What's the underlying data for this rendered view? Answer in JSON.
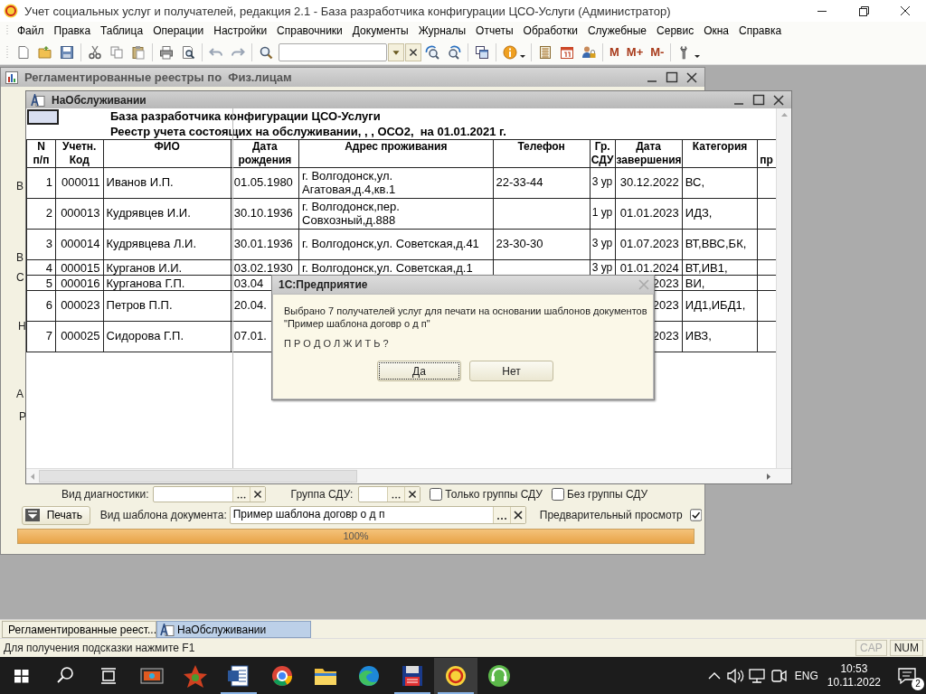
{
  "window": {
    "title": "Учет социальных услуг и получателей, редакция 2.1 - База разработчика конфигурации ЦСО-Услуги (Администратор)"
  },
  "menu": [
    "Файл",
    "Правка",
    "Таблица",
    "Операции",
    "Настройки",
    "Справочники",
    "Документы",
    "Журналы",
    "Отчеты",
    "Обработки",
    "Служебные",
    "Сервис",
    "Окна",
    "Справка"
  ],
  "toolbar": {
    "memory_buttons": [
      "M",
      "M+",
      "M-"
    ]
  },
  "back_window": {
    "title": "Регламентированные реестры по  Физ.лицам",
    "covered_labels": [
      "В",
      "В",
      "С",
      "Н",
      "А",
      "Р"
    ],
    "form": {
      "diagnostic": {
        "label": "Вид диагностики:"
      },
      "group": {
        "label": "Группа СДУ:"
      },
      "checkboxes": [
        {
          "label": "Только группы СДУ",
          "checked": false
        },
        {
          "label": "Без группы СДУ",
          "checked": false
        }
      ],
      "print_button": "Печать",
      "template": {
        "label": "Вид шаблона документа:",
        "value": "Пример шаблона договр о д п"
      },
      "preview": {
        "label": "Предварительный просмотр",
        "checked": true
      },
      "progress": {
        "level": 1,
        "reading": "100%"
      }
    }
  },
  "report_window": {
    "title": "НаОбслуживании",
    "heading": "База разработчика конфигурации ЦСО-Услуги",
    "subtitle": "Реестр учета состоящих на обслуживании, , , ОСО2,  на 01.01.2021 г.",
    "table": {
      "columns": [
        "N\nп/п",
        "Учетн.\nКод",
        "ФИО",
        "Дата\nрождения",
        "Адрес проживания",
        "Телефон",
        "Гр.\nСДУ",
        "Дата\nзавершения",
        "Категория",
        "пр"
      ],
      "rows": [
        [
          "1",
          "000011",
          "Иванов И.П.",
          "01.05.1980",
          "г. Волгодонск,ул.\nАгатовая,д.4,кв.1",
          "22-33-44",
          "3 ур",
          "30.12.2022",
          "ВС,",
          ""
        ],
        [
          "2",
          "000013",
          "Кудрявцев И.И.",
          "30.10.1936",
          "г. Волгодонск,пер.\nСовхозный,д.888",
          "",
          "1 ур",
          "01.01.2023",
          "ИДЗ,",
          ""
        ],
        [
          "3",
          "000014",
          "Кудрявцева Л.И.",
          "30.01.1936",
          "г. Волгодонск,ул. Советская,д.41",
          "23-30-30",
          "3 ур",
          "01.07.2023",
          "ВТ,ВВС,БК,",
          ""
        ],
        [
          "4",
          "000015",
          "Курганов И.И.",
          "03.02.1930",
          "г. Волгодонск,ул. Советская,д.1",
          "",
          "3 ур",
          "01.01.2024",
          "ВТ,ИВ1,",
          ""
        ],
        [
          "5",
          "000016",
          "Курганова Г.П.",
          "03.04",
          "",
          "",
          "",
          "2023",
          "ВИ,",
          ""
        ],
        [
          "6",
          "000023",
          "Петров П.П.",
          "20.04.",
          "",
          "",
          "",
          "2023",
          "ИД1,ИБД1,",
          ""
        ],
        [
          "7",
          "000025",
          "Сидорова Г.П.",
          "07.01.",
          "",
          "",
          "",
          "2023",
          "ИВЗ,",
          ""
        ]
      ]
    }
  },
  "dialog": {
    "title": "1С:Предприятие",
    "message": "Выбрано 7 получателей услуг для печати на основании шаблонов документов\n\"Пример шаблона договр о д п\"",
    "question": "П Р О Д О Л Ж И Т Ь ?",
    "buttons": [
      {
        "label": "Да",
        "focused": true
      },
      {
        "label": "Нет",
        "focused": false
      }
    ]
  },
  "window_tabs": [
    {
      "label": "Регламентированные реест...",
      "selected": false
    },
    {
      "label": "НаОбслуживании",
      "selected": true
    }
  ],
  "status_bar": {
    "hint": "Для получения подсказки нажмите F1",
    "indicators": [
      {
        "label": "CAP",
        "on": false
      },
      {
        "label": "NUM",
        "on": true
      }
    ]
  },
  "taskbar": {
    "apps": [
      {
        "kind": "media",
        "running": false,
        "active": false
      },
      {
        "kind": "game",
        "running": false,
        "active": false
      },
      {
        "kind": "word",
        "running": true,
        "active": false
      },
      {
        "kind": "chrome",
        "running": false,
        "active": false
      },
      {
        "kind": "folder",
        "running": false,
        "active": false
      },
      {
        "kind": "edge",
        "running": false,
        "active": false
      },
      {
        "kind": "floppy",
        "running": true,
        "active": false
      },
      {
        "kind": "onec",
        "running": true,
        "active": true
      },
      {
        "kind": "headset",
        "running": false,
        "active": false
      }
    ],
    "language": "ENG",
    "time": "10:53",
    "date": "10.11.2022",
    "notification_count": "2"
  }
}
